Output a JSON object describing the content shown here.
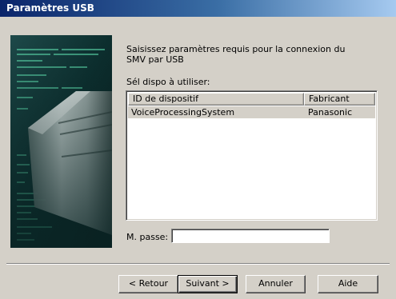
{
  "window": {
    "title": "Paramètres USB"
  },
  "instruction": "Saisissez paramètres requis pour la connexion du SMV par USB",
  "device_label": "Sél dispo à utiliser:",
  "device_list": {
    "columns": [
      "ID de dispositif",
      "Fabricant"
    ],
    "rows": [
      {
        "id": "VoiceProcessingSystem",
        "manufacturer": "Panasonic",
        "selected": true
      }
    ]
  },
  "password": {
    "label": "M. passe:",
    "value": ""
  },
  "buttons": {
    "back": "< Retour",
    "next": "Suivant >",
    "cancel": "Annuler",
    "help": "Aide"
  },
  "colors": {
    "titlebar_start": "#0a246a",
    "titlebar_end": "#a6caf0",
    "dialog_bg": "#d4d0c8"
  }
}
